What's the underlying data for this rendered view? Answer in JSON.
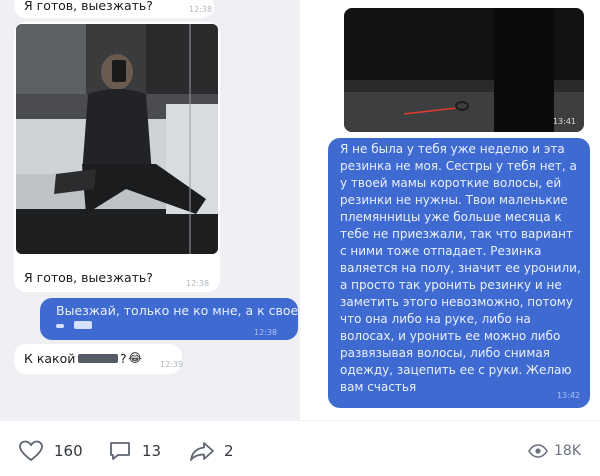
{
  "left_chat": {
    "top_cut_text": "Я готов, выезжать?",
    "top_cut_time": "12:38",
    "photo_message": {
      "text": "Я готов, выезжать?",
      "time": "12:38"
    },
    "outgoing_message": {
      "line1": "Выезжай, только не ко мне, а к своей",
      "time": "12:38"
    },
    "reply_message": {
      "prefix": "К какой",
      "suffix": "?",
      "emoji": "😂",
      "time": "12:39"
    }
  },
  "right_chat": {
    "photo_time": "13:41",
    "long_message": {
      "lines": [
        "Я не была у тебя уже неделю и эта",
        "резинка не моя. Сестры у тебя нет, а",
        "у твоей мамы короткие волосы, ей",
        "резинки не нужны. Твои маленькие",
        "племянницы уже больше месяца к",
        "тебе не приезжали, так что вариант",
        "с ними тоже отпадает. Резинка",
        "валяется на полу, значит ее уронили,",
        "а просто так уронить резинку и не",
        "заметить этого невозможно, потому",
        "что она либо на руке, либо на",
        "волосах, и уронить ее можно либо",
        "развязывая волосы, либо снимая",
        "одежду, зацепить ее с руки. Желаю",
        "вам счастья"
      ],
      "time": "13:42"
    }
  },
  "footer": {
    "likes": "160",
    "comments": "13",
    "shares": "2",
    "views": "18K"
  },
  "colors": {
    "outgoing_bubble": "#3e6ad2",
    "incoming_bubble": "#ffffff",
    "chat_background": "#eef0f4"
  }
}
